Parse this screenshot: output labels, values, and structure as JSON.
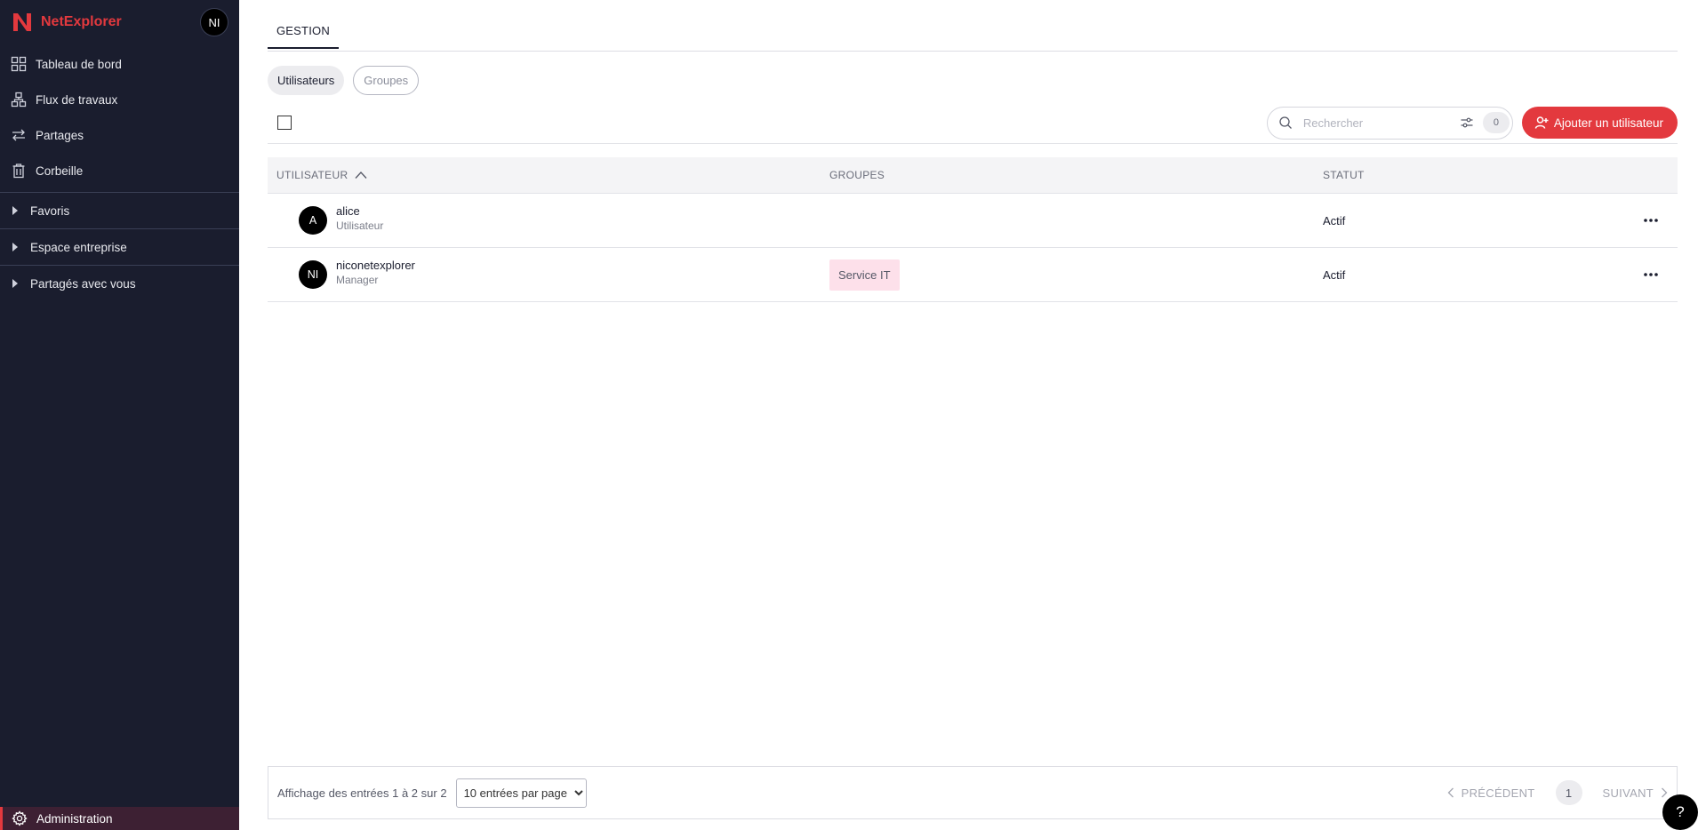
{
  "app": {
    "name": "NetExplorer",
    "user_initials": "NI",
    "brand_color": "#e3393e",
    "sidebar_bg": "#1a1d2e"
  },
  "sidebar": {
    "nav": [
      {
        "label": "Tableau de bord",
        "icon": "dashboard-icon"
      },
      {
        "label": "Flux de travaux",
        "icon": "workflow-icon"
      },
      {
        "label": "Partages",
        "icon": "share-icon"
      },
      {
        "label": "Corbeille",
        "icon": "trash-icon"
      }
    ],
    "tree": [
      {
        "label": "Favoris"
      },
      {
        "label": "Espace entreprise"
      },
      {
        "label": "Partagés avec vous"
      }
    ],
    "admin_label": "Administration"
  },
  "main": {
    "tab_label": "GESTION",
    "subtabs": {
      "users": "Utilisateurs",
      "groups": "Groupes"
    },
    "search": {
      "placeholder": "Rechercher",
      "filter_count": "0"
    },
    "add_button_label": "Ajouter un utilisateur",
    "table": {
      "headers": {
        "user": "UTILISATEUR",
        "groups": "GROUPES",
        "status": "STATUT"
      },
      "rows": [
        {
          "initials": "A",
          "name": "alice",
          "role": "Utilisateur",
          "group": "",
          "status": "Actif"
        },
        {
          "initials": "NI",
          "name": "niconetexplorer",
          "role": "Manager",
          "group": "Service IT",
          "status": "Actif"
        }
      ]
    },
    "footer": {
      "info": "Affichage des entrées 1 à 2 sur 2",
      "per_page": "10 entrées par page",
      "prev": "PRÉCÉDENT",
      "page": "1",
      "next": "SUIVANT"
    },
    "help_label": "?"
  }
}
